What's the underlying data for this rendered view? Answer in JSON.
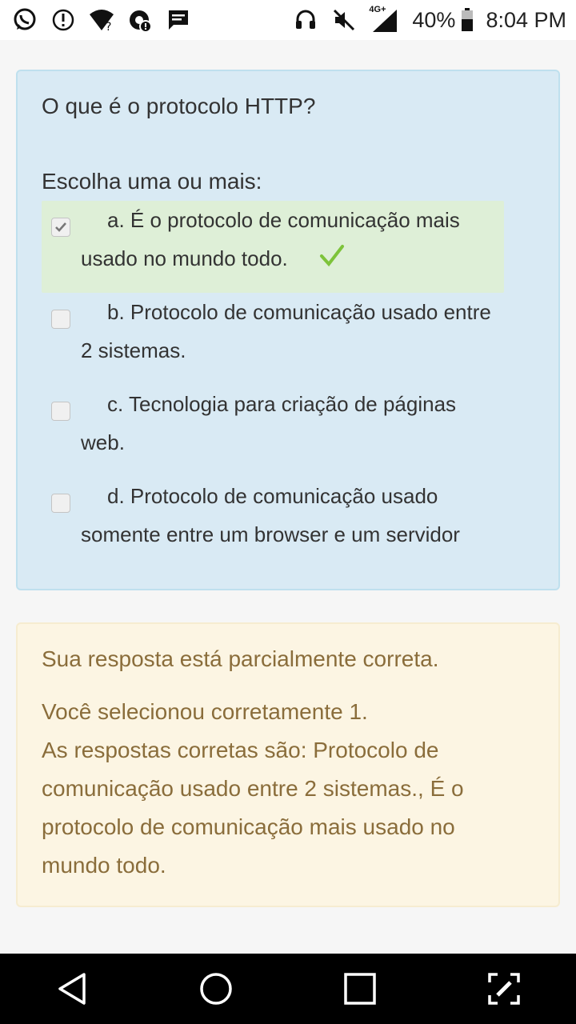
{
  "status_bar": {
    "battery_percent": "40%",
    "time": "8:04 PM",
    "network": "4G+",
    "left_icons": [
      "whatsapp-icon",
      "alert-icon",
      "wifi-question-icon",
      "data-saver-icon",
      "message-icon"
    ],
    "right_icons": [
      "headset-icon",
      "mute-icon",
      "signal-icon",
      "battery-icon"
    ]
  },
  "question": {
    "title": "O que é o protocolo HTTP?",
    "prompt": "Escolha uma ou mais:",
    "options": [
      {
        "text": "a. É o protocolo de comunicação mais usado no mundo todo.",
        "checked": true,
        "correct": true
      },
      {
        "text": "b. Protocolo de comunicação usado entre 2 sistemas.",
        "checked": false,
        "correct": false
      },
      {
        "text": "c. Tecnologia para criação de páginas web.",
        "checked": false,
        "correct": false
      },
      {
        "text": "d. Protocolo de comunicação usado somente entre um browser e um servidor",
        "checked": false,
        "correct": false
      }
    ]
  },
  "feedback": {
    "status": "Sua resposta está parcialmente correta.",
    "selected": "Você selecionou corretamente 1.",
    "correct_answers": "As respostas corretas são: Protocolo de comunicação usado entre 2 sistemas., É o protocolo de comunicação mais usado no mundo todo."
  },
  "nav_bar": {
    "buttons": [
      "back-icon",
      "home-icon",
      "recents-icon",
      "fullscreen-icon"
    ]
  },
  "colors": {
    "question_bg": "#d9eaf4",
    "correct_bg": "#deefd7",
    "feedback_bg": "#fcf5e3",
    "feedback_text": "#8a6d3b",
    "tick": "#7dc33a"
  }
}
